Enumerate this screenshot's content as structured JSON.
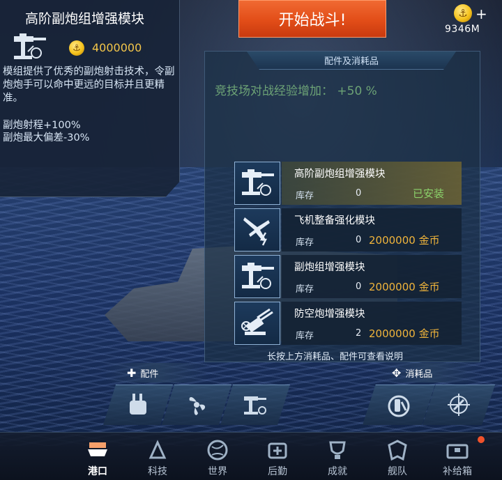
{
  "info_panel": {
    "title": "高阶副炮组增强模块",
    "price": "4000000",
    "icon": "secondary-gun-module-icon",
    "description": "模组提供了优秀的副炮射击技术，令副炮炮手可以命中更远的目标并且更精准。",
    "stats": [
      "副炮射程+100%",
      "副炮最大偏差-30%"
    ]
  },
  "start_battle": {
    "label": "开始战斗!"
  },
  "currency": {
    "amount": "9346M",
    "plus": "+",
    "icon": "gold-anchor-coin-icon"
  },
  "parts_panel": {
    "header": "配件及消耗品",
    "bonus_text": "竞技场对战经验增加： +50 %",
    "stock_label": "库存",
    "modules": [
      {
        "name": "高阶副炮组增强模块",
        "stock": "0",
        "status": "已安装",
        "price": "",
        "icon": "secondary-gun-module-icon"
      },
      {
        "name": "飞机整备强化模块",
        "stock": "0",
        "status": "",
        "price": "2000000 金币",
        "icon": "aircraft-module-icon"
      },
      {
        "name": "副炮组增强模块",
        "stock": "0",
        "status": "",
        "price": "2000000 金币",
        "icon": "secondary-gun-module-icon"
      },
      {
        "name": "防空炮增强模块",
        "stock": "2",
        "status": "",
        "price": "2000000 金币",
        "icon": "anti-air-module-icon"
      }
    ],
    "hint": "长按上方消耗品、配件可查看说明"
  },
  "slots": {
    "parts_label": "配件",
    "consumables_label": "消耗品",
    "parts_icons": [
      "damage-control-icon",
      "propeller-icon",
      "secondary-gun-icon"
    ],
    "consumable_icons": [
      "repair-kit-icon",
      "target-crosshair-icon"
    ]
  },
  "nav": [
    {
      "label": "港口",
      "icon": "harbor-icon",
      "active": true
    },
    {
      "label": "科技",
      "icon": "tech-icon",
      "active": false
    },
    {
      "label": "世界",
      "icon": "world-icon",
      "active": false
    },
    {
      "label": "后勤",
      "icon": "logistics-icon",
      "active": false
    },
    {
      "label": "成就",
      "icon": "achievement-icon",
      "active": false
    },
    {
      "label": "舰队",
      "icon": "fleet-icon",
      "active": false
    },
    {
      "label": "补给箱",
      "icon": "supply-box-icon",
      "active": false
    }
  ],
  "colors": {
    "accent_orange": "#e24d18",
    "price_gold": "#f0b43b",
    "installed_green": "#8bd16a"
  }
}
